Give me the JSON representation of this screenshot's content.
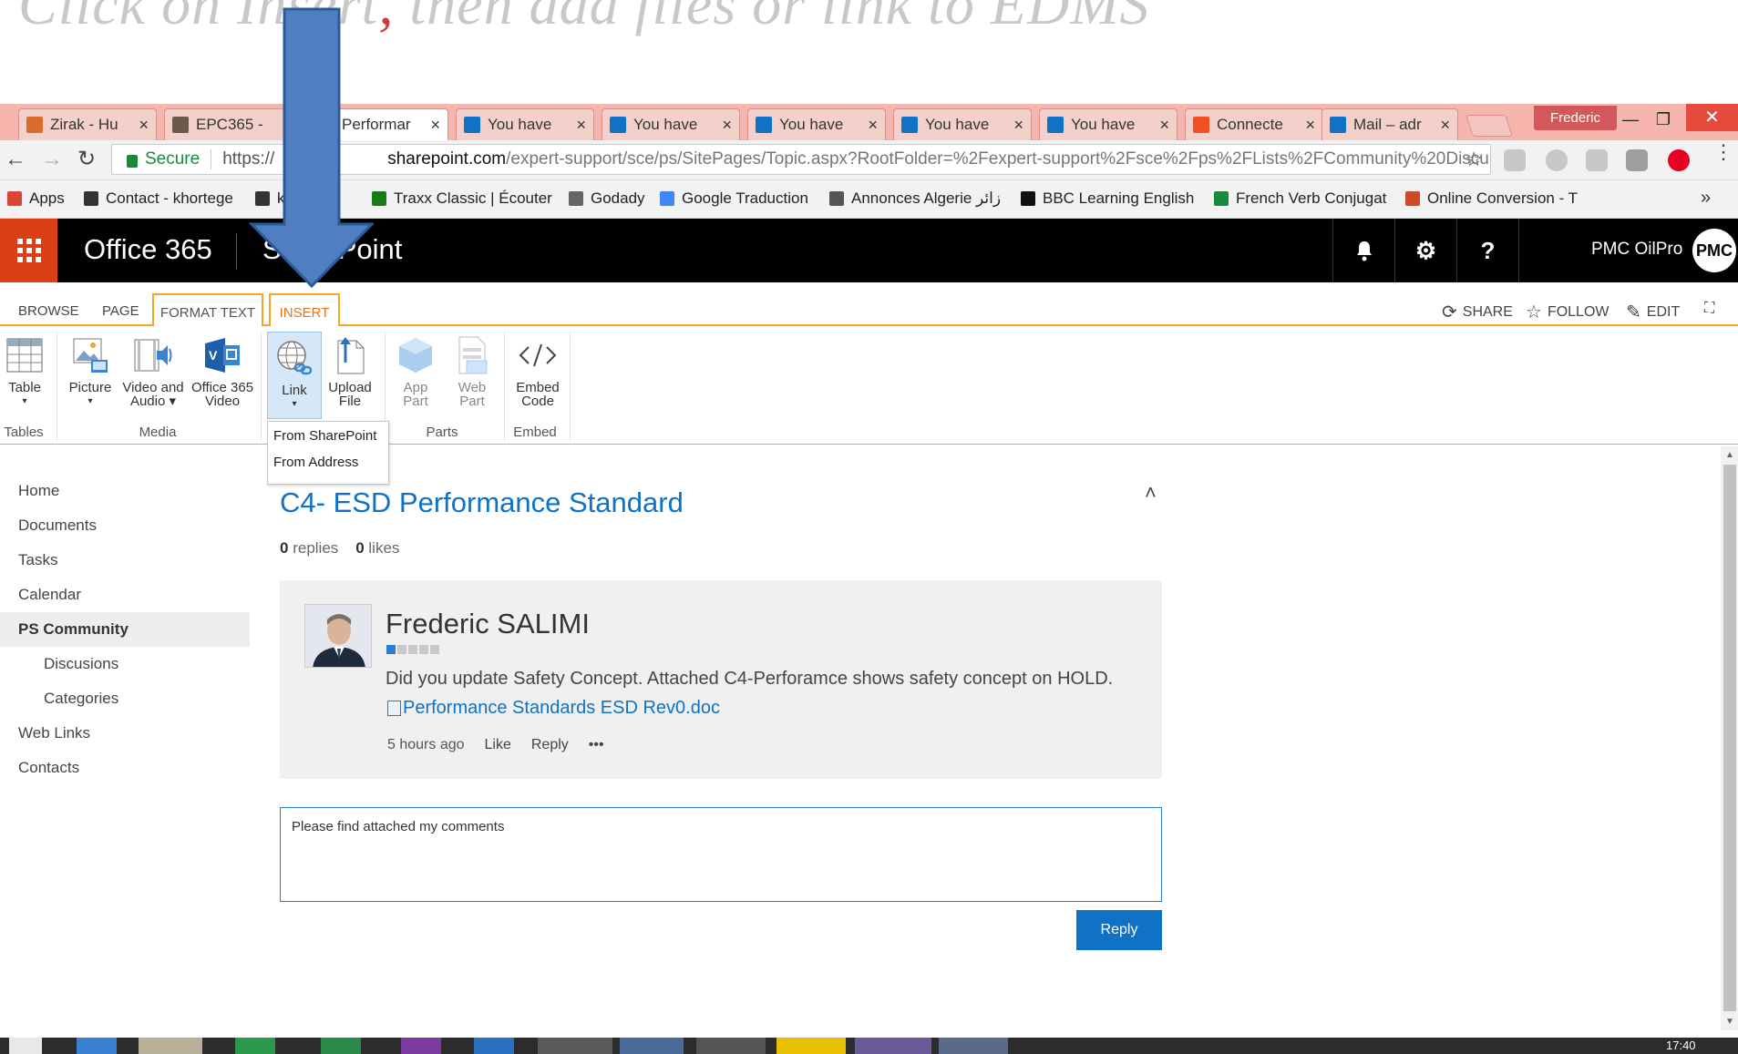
{
  "slide": {
    "caption_pre": "Click on Insert",
    "caption_red": ",",
    "caption_post": " then add files or link to EDMS"
  },
  "tabs": [
    {
      "title": "Zirak - Hu",
      "icon_color": "#d96b2b"
    },
    {
      "title": "EPC365 -",
      "icon_color": "#6b5a4a"
    },
    {
      "title": "Performar",
      "icon_color": "#0f72c4"
    },
    {
      "title": "You have",
      "icon_color": "#0f72c4"
    },
    {
      "title": "You have",
      "icon_color": "#0f72c4"
    },
    {
      "title": "You have",
      "icon_color": "#0f72c4"
    },
    {
      "title": "You have",
      "icon_color": "#0f72c4"
    },
    {
      "title": "You have",
      "icon_color": "#0f72c4"
    },
    {
      "title": "Connecte",
      "icon_color": "#f25022"
    },
    {
      "title": "Mail – adr",
      "icon_color": "#0f72c4"
    }
  ],
  "browser": {
    "profile": "Frederic",
    "secure_label": "Secure",
    "url_proto": "https://",
    "url_host": "sharepoint.com",
    "url_path": "/expert-support/sce/ps/SitePages/Topic.aspx?RootFolder=%2Fexpert-support%2Fsce%2Fps%2FLists%2FCommunity%20Discu"
  },
  "bookmarks": [
    {
      "label": "Apps",
      "icon": "apps-grid-icon",
      "color": "#db4437"
    },
    {
      "label": "Contact - khortege",
      "icon": "contact-icon",
      "color": "#333333"
    },
    {
      "label": "ks",
      "icon": "bookmark-star-icon",
      "color": "#333333"
    },
    {
      "label": "Traxx Classic | Écouter",
      "icon": "traxx-icon",
      "color": "#1a7a1a"
    },
    {
      "label": "Godady",
      "icon": "godaddy-icon",
      "color": "#666666"
    },
    {
      "label": "Google Traduction",
      "icon": "google-translate-icon",
      "color": "#4285f4"
    },
    {
      "label": "Annonces Algerie زائر",
      "icon": "annonces-icon",
      "color": "#555555"
    },
    {
      "label": "BBC Learning English",
      "icon": "bbc-icon",
      "color": "#111111"
    },
    {
      "label": "French Verb Conjugat",
      "icon": "french-verb-icon",
      "color": "#1a8a3a"
    },
    {
      "label": "Online Conversion - T",
      "icon": "conversion-icon",
      "color": "#d04a2a"
    }
  ],
  "suite": {
    "title": "Office 365",
    "app": "SharePoint",
    "user": "PMC OilPro",
    "user_badge": "PMC"
  },
  "ribbon": {
    "tabs": [
      "BROWSE",
      "PAGE",
      "FORMAT TEXT",
      "INSERT"
    ],
    "actions": [
      "SHARE",
      "FOLLOW",
      "EDIT"
    ],
    "buttons": {
      "table": "Table",
      "picture": "Picture",
      "video_audio": [
        "Video and",
        "Audio"
      ],
      "o365_video": [
        "Office 365",
        "Video"
      ],
      "link": "Link",
      "upload_file": [
        "Upload",
        "File"
      ],
      "app_part": [
        "App",
        "Part"
      ],
      "web_part": [
        "Web",
        "Part"
      ],
      "embed_code": [
        "Embed",
        "Code"
      ]
    },
    "groups": [
      "Tables",
      "Media",
      "Parts",
      "Embed"
    ],
    "link_menu": [
      "From SharePoint",
      "From Address"
    ]
  },
  "leftnav": [
    {
      "label": "Home"
    },
    {
      "label": "Documents"
    },
    {
      "label": "Tasks"
    },
    {
      "label": "Calendar"
    },
    {
      "label": "PS Community",
      "selected": true
    },
    {
      "label": "Discusions",
      "sub": true
    },
    {
      "label": "Categories",
      "sub": true
    },
    {
      "label": "Web Links"
    },
    {
      "label": "Contacts"
    }
  ],
  "post": {
    "title": "C4- ESD Performance Standard",
    "replies_count": "0",
    "replies_label": "replies",
    "likes_count": "0",
    "likes_label": "likes"
  },
  "reply": {
    "author": "Frederic SALIMI",
    "body_text": "Did you update Safety Concept. Attached C4-Perforamce shows safety concept on HOLD.",
    "attachment": "Performance Standards ESD Rev0.doc",
    "time": "5 hours ago",
    "like": "Like",
    "reply": "Reply",
    "more": "•••",
    "rank": 1
  },
  "compose": {
    "text": "Please find attached my comments",
    "button": "Reply"
  },
  "taskbar": {
    "clock": "17:40"
  }
}
